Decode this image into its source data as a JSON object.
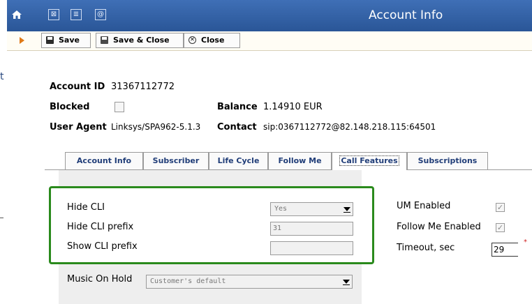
{
  "header": {
    "title": "Account Info",
    "icons": [
      "home-icon",
      "mail-icon",
      "document-icon",
      "at-icon"
    ]
  },
  "toolbar": {
    "save_label": "Save",
    "save_close_label": "Save & Close",
    "close_label": "Close"
  },
  "edge_text": "t",
  "account": {
    "id_label": "Account ID",
    "id_value": "31367112772",
    "blocked_label": "Blocked",
    "balance_label": "Balance",
    "balance_value": "1.14910 EUR",
    "user_agent_label": "User Agent",
    "user_agent_value": "Linksys/SPA962-5.1.3",
    "contact_label": "Contact",
    "contact_value": "sip:0367112772@82.148.218.115:64501"
  },
  "tabs": [
    {
      "label": "Account Info"
    },
    {
      "label": "Subscriber"
    },
    {
      "label": "Life Cycle"
    },
    {
      "label": "Follow Me"
    },
    {
      "label": "Call Features",
      "active": true
    },
    {
      "label": "Subscriptions"
    }
  ],
  "call_features": {
    "hide_cli_label": "Hide CLI",
    "hide_cli_value": "Yes",
    "hide_cli_prefix_label": "Hide CLI prefix",
    "hide_cli_prefix_value": "31",
    "show_cli_prefix_label": "Show CLI prefix",
    "show_cli_prefix_value": "",
    "music_on_hold_label": "Music On Hold",
    "music_on_hold_value": "Customer's default",
    "um_enabled_label": "UM Enabled",
    "um_enabled_checked": true,
    "follow_me_enabled_label": "Follow Me Enabled",
    "follow_me_enabled_checked": true,
    "timeout_label": "Timeout, sec",
    "timeout_value": "29",
    "required_mark": "*"
  },
  "colors": {
    "title_bar": "#2f5fa6",
    "highlight_border": "#2a8a1c",
    "tab_text": "#203d78"
  }
}
